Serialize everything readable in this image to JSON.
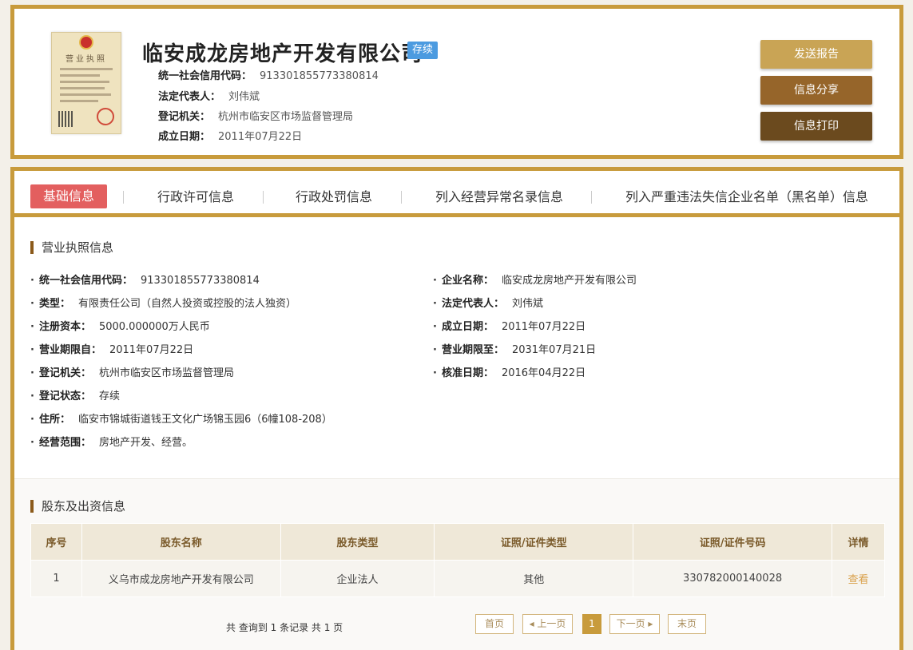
{
  "header": {
    "company_name": "临安成龙房地产开发有限公司",
    "status": "存续",
    "rows": [
      {
        "key": "统一社会信用代码：",
        "value": "913301855773380814"
      },
      {
        "key": "法定代表人：",
        "value": "刘伟斌"
      },
      {
        "key": "登记机关：",
        "value": "杭州市临安区市场监督管理局"
      },
      {
        "key": "成立日期：",
        "value": "2011年07月22日"
      }
    ],
    "buttons": [
      "发送报告",
      "信息分享",
      "信息打印"
    ],
    "license_title": "营业执照"
  },
  "tabs": [
    "基础信息",
    "行政许可信息",
    "行政处罚信息",
    "列入经营异常名录信息",
    "列入严重违法失信企业名单（黑名单）信息"
  ],
  "license_section": {
    "title": "营业执照信息",
    "left": [
      {
        "key": "统一社会信用代码：",
        "value": "913301855773380814"
      },
      {
        "key": "类型：",
        "value": "有限责任公司（自然人投资或控股的法人独资）"
      },
      {
        "key": "注册资本：",
        "value": "5000.000000万人民币"
      },
      {
        "key": "营业期限自：",
        "value": "2011年07月22日"
      },
      {
        "key": "登记机关：",
        "value": "杭州市临安区市场监督管理局"
      },
      {
        "key": "登记状态：",
        "value": "存续"
      },
      {
        "key": "住所：",
        "value": "临安市锦城街道钱王文化广场锦玉园6（6幢108-208）"
      },
      {
        "key": "经营范围：",
        "value": "房地产开发、经营。"
      }
    ],
    "right": [
      {
        "key": "企业名称：",
        "value": "临安成龙房地产开发有限公司"
      },
      {
        "key": "法定代表人：",
        "value": "刘伟斌"
      },
      {
        "key": "成立日期：",
        "value": "2011年07月22日"
      },
      {
        "key": "营业期限至：",
        "value": "2031年07月21日"
      },
      {
        "key": "核准日期：",
        "value": "2016年04月22日"
      }
    ]
  },
  "shareholders": {
    "title": "股东及出资信息",
    "columns": [
      "序号",
      "股东名称",
      "股东类型",
      "证照/证件类型",
      "证照/证件号码",
      "详情"
    ],
    "rows": [
      [
        "1",
        "义乌市成龙房地产开发有限公司",
        "企业法人",
        "其他",
        "330782000140028",
        "查看"
      ]
    ],
    "pager_info": "共 查询到 1 条记录 共 1 页",
    "pager": {
      "first": "首页",
      "prev": "◂ 上一页",
      "current": "1",
      "next": "下一页 ▸",
      "last": "末页"
    }
  },
  "colors": {
    "accent": "#c89b3c",
    "active_tab": "#e35f5f",
    "status_tag": "#4c9be0"
  }
}
